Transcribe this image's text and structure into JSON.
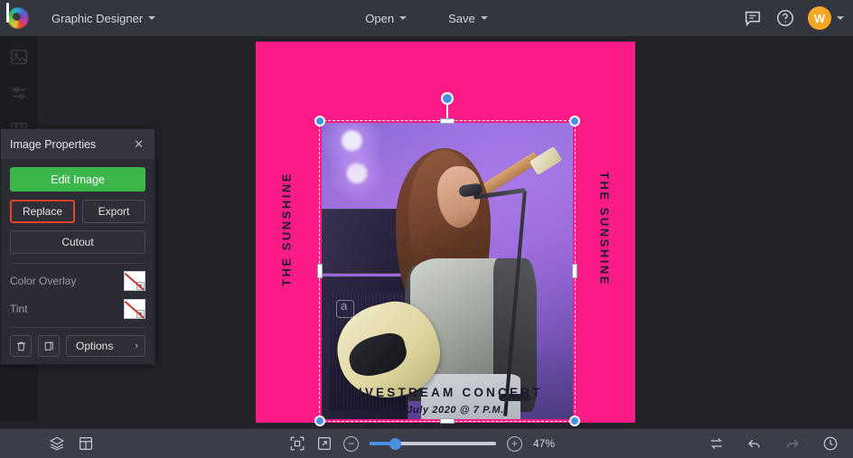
{
  "topbar": {
    "logo_icon": "pixlr-logo-icon",
    "app_name": "Graphic Designer",
    "menus": [
      {
        "label": "Open",
        "name": "open-menu-button"
      },
      {
        "label": "Save",
        "name": "save-menu-button"
      }
    ],
    "feedback_icon": "comment-icon",
    "help_icon": "help-circle-icon",
    "avatar_initial": "W",
    "avatar_color": "#f5a623"
  },
  "left_rail": {
    "items": [
      {
        "name": "sidebar-item-image",
        "icon": "image-icon"
      },
      {
        "name": "sidebar-item-adjust",
        "icon": "adjust-icon"
      },
      {
        "name": "sidebar-item-layout",
        "icon": "columns-icon"
      }
    ]
  },
  "panel": {
    "title": "Image Properties",
    "close_icon": "close-icon",
    "edit_label": "Edit Image",
    "replace_label": "Replace",
    "export_label": "Export",
    "cutout_label": "Cutout",
    "color_overlay_label": "Color Overlay",
    "tint_label": "Tint",
    "swatch_state": "none",
    "delete_icon": "trash-icon",
    "duplicate_icon": "duplicate-icon",
    "options_label": "Options",
    "options_chevron": "chevron-right-icon",
    "accent_green": "#3cb54a",
    "highlight_red": "#e8412a"
  },
  "canvas": {
    "poster": {
      "background_color": "#fc1c87",
      "left_side_text": "THE SUNSHINE",
      "right_side_text": "THE SUNSHINE",
      "title": "LIVESTREAM CONCERT",
      "subtitle": "7th July 2020 @ 7 P.M.",
      "text_color": "#18182c"
    },
    "selection": {
      "handle_color": "#4a90e2",
      "rotate_handle_icon": "rotate-handle-icon"
    }
  },
  "bottombar": {
    "layers_icon": "layers-icon",
    "template_icon": "template-grid-icon",
    "fit_icon": "fit-to-screen-icon",
    "expand_icon": "expand-arrow-icon",
    "zoom_out_label": "−",
    "zoom_in_label": "+",
    "zoom_value": "47%",
    "zoom_percent": 47,
    "swap_icon": "swap-icon",
    "undo_icon": "undo-icon",
    "redo_icon": "redo-icon",
    "history_icon": "history-clock-icon"
  }
}
